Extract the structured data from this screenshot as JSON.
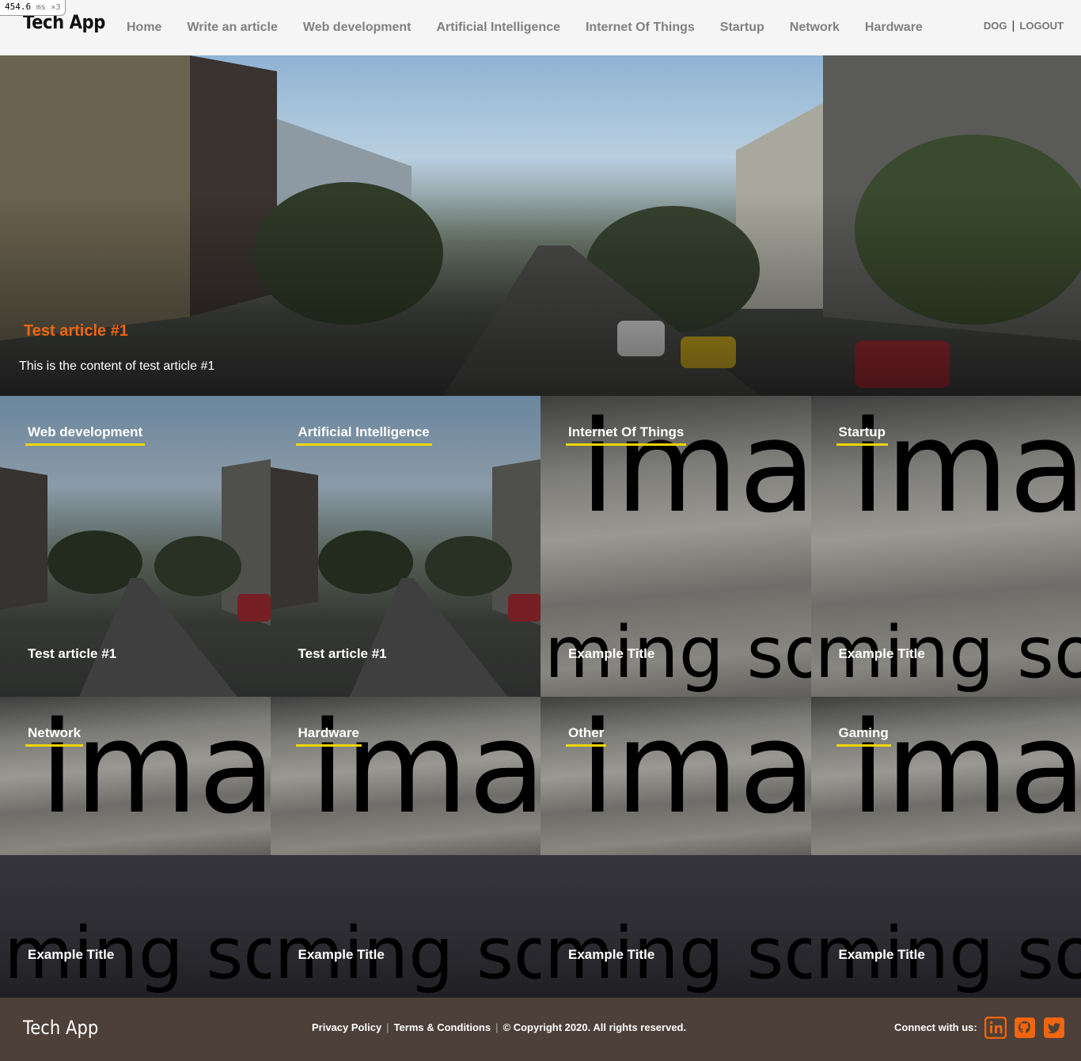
{
  "perf": {
    "value": "454.6",
    "unit": "ms",
    "mult": "×3"
  },
  "header": {
    "logo": "Tech App",
    "nav": [
      "Home",
      "Write an article",
      "Web development",
      "Artificial Intelligence",
      "Internet Of Things",
      "Startup",
      "Network",
      "Hardware"
    ],
    "user": "DOG",
    "logout": "LOGOUT"
  },
  "hero": {
    "title": "Test article #1",
    "content": "This is the content of test article #1"
  },
  "tiles": [
    {
      "category": "Web development",
      "title": "Test article #1"
    },
    {
      "category": "Artificial Intelligence",
      "title": "Test article #1"
    },
    {
      "category": "Internet Of Things",
      "title": "Example Title"
    },
    {
      "category": "Startup",
      "title": "Example Title"
    },
    {
      "category": "Network",
      "title": "Example Title"
    },
    {
      "category": "Hardware",
      "title": "Example Title"
    },
    {
      "category": "Other",
      "title": "Example Title"
    },
    {
      "category": "Gaming",
      "title": "Example Title"
    }
  ],
  "placeholder_text": {
    "top": "ima",
    "bottom": "ming soming so"
  },
  "footer": {
    "logo": "Tech App",
    "privacy": "Privacy Policy",
    "terms": "Terms & Conditions",
    "copyright": "© Copyright 2020. All rights reserved.",
    "connect": "Connect with us:",
    "social": [
      "linkedin-icon",
      "github-icon",
      "twitter-icon"
    ],
    "accent": "#f0650e"
  }
}
